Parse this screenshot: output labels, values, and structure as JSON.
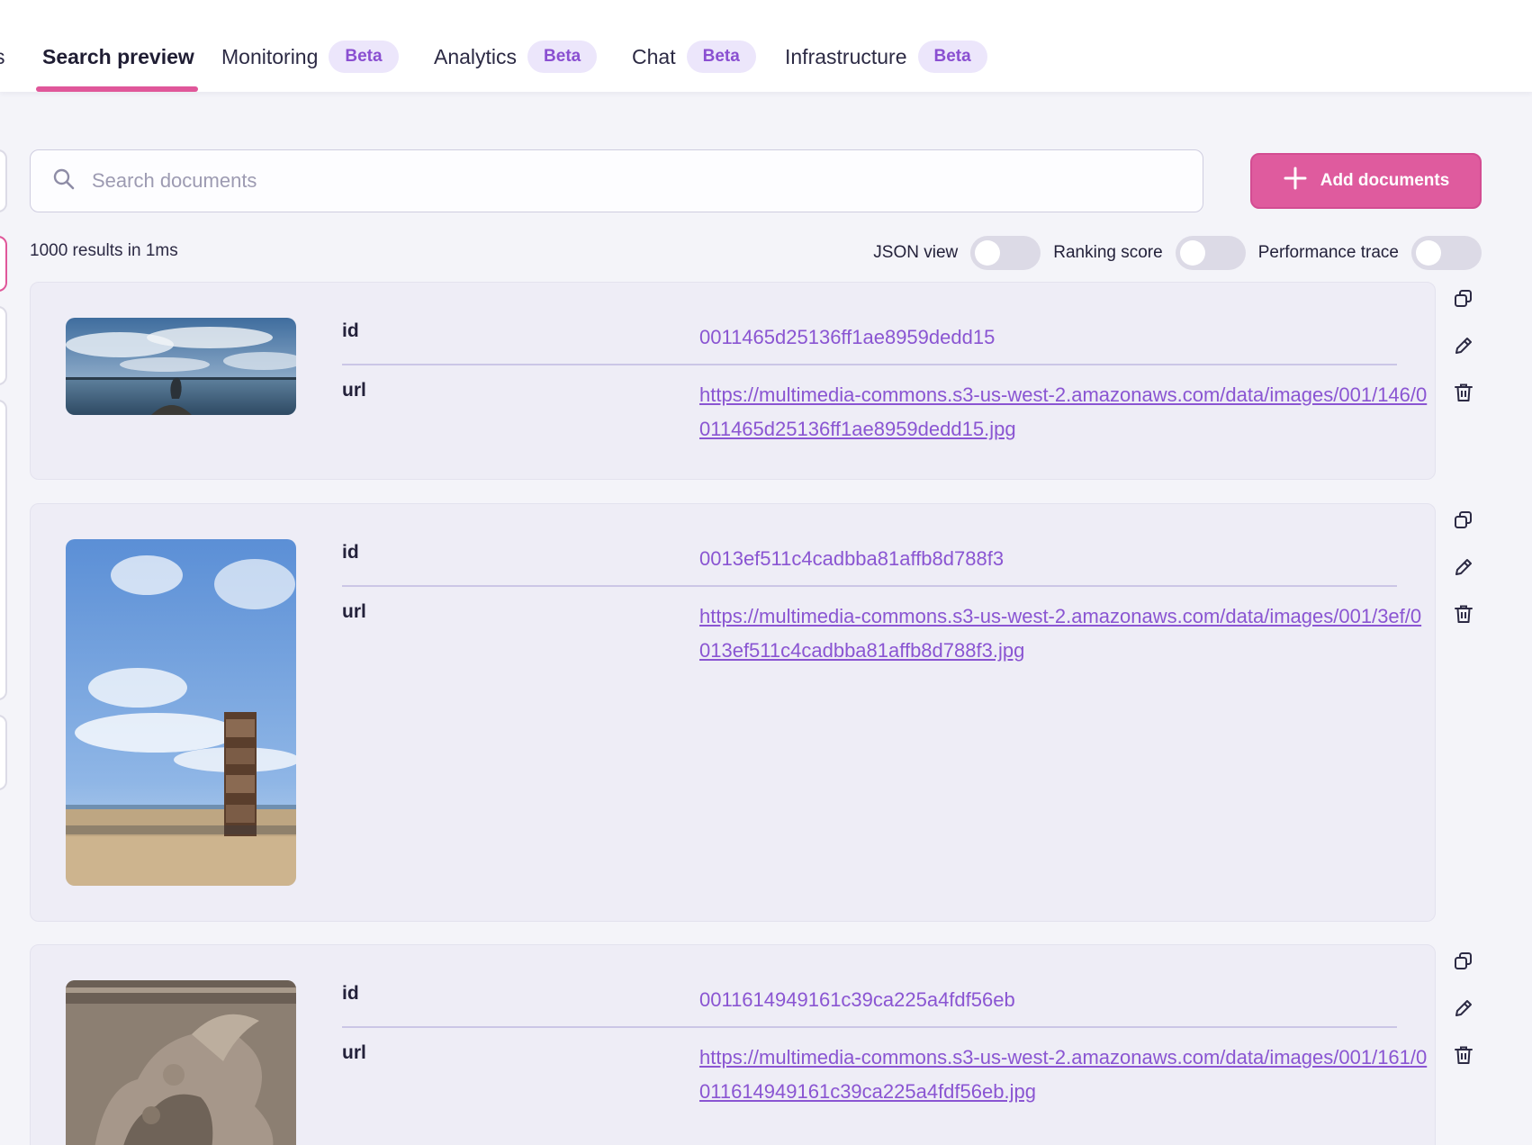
{
  "nav": {
    "partial_tab": "s",
    "tabs": [
      {
        "label": "Search preview",
        "badge": ""
      },
      {
        "label": "Monitoring",
        "badge": "Beta"
      },
      {
        "label": "Analytics",
        "badge": "Beta"
      },
      {
        "label": "Chat",
        "badge": "Beta"
      },
      {
        "label": "Infrastructure",
        "badge": "Beta"
      }
    ]
  },
  "search": {
    "placeholder": "Search documents",
    "add_button_label": "Add documents"
  },
  "results": {
    "summary": "1000 results in 1ms",
    "toggles": [
      {
        "label": "JSON view",
        "on": false
      },
      {
        "label": "Ranking score",
        "on": false
      },
      {
        "label": "Performance trace",
        "on": false
      }
    ]
  },
  "documents": [
    {
      "id_key": "id",
      "id_value": "0011465d25136ff1ae8959dedd15",
      "url_key": "url",
      "url_value": "https://multimedia-commons.s3-us-west-2.amazonaws.com/data/images/001/146/0011465d25136ff1ae8959dedd15.jpg",
      "thumbnail_icon": "harbor-statue-photo"
    },
    {
      "id_key": "id",
      "id_value": "0013ef511c4cadbba81affb8d788f3",
      "url_key": "url",
      "url_value": "https://multimedia-commons.s3-us-west-2.amazonaws.com/data/images/001/3ef/0013ef511c4cadbba81affb8d788f3.jpg",
      "thumbnail_icon": "beach-tower-photo"
    },
    {
      "id_key": "id",
      "id_value": "0011614949161c39ca225a4fdf56eb",
      "url_key": "url",
      "url_value": "https://multimedia-commons.s3-us-west-2.amazonaws.com/data/images/001/161/0011614949161c39ca225a4fdf56eb.jpg",
      "thumbnail_icon": "stone-relief-photo"
    }
  ],
  "colors": {
    "accent_pink": "#df5b9e",
    "badge_bg": "#ece6fb",
    "badge_text": "#8a4fd1",
    "value_purple": "#8a55d2"
  }
}
